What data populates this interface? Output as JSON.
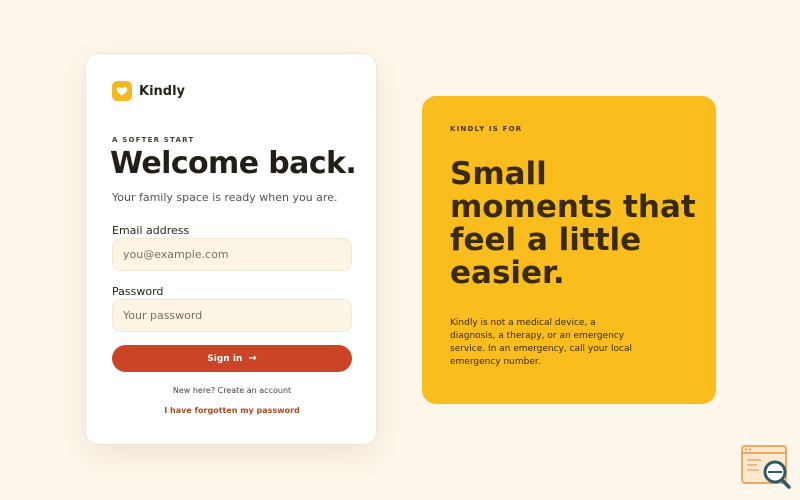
{
  "brand": {
    "name": "Kindly",
    "icon": "heart-icon",
    "accent": "#f5b820"
  },
  "login": {
    "eyebrow": "A SOFTER START",
    "title": "Welcome back.",
    "subtitle": "Your family space is ready when you are.",
    "email_label": "Email address",
    "email_value": "",
    "email_placeholder": "you@example.com",
    "password_label": "Password",
    "password_value": "",
    "password_placeholder": "Your password",
    "signin_label": "Sign in",
    "signin_icon": "arrow-right-icon",
    "create_account": "New here? Create an account",
    "forgot_password": "I have forgotten my password"
  },
  "promo": {
    "eyebrow": "KINDLY IS FOR",
    "headline": "Small moments that feel a little easier.",
    "body": "Kindly is not a medical device, a diagnosis, a therapy, or an emergency service. In an emergency, call your local emergency number."
  },
  "colors": {
    "page_background": "#fdf6ea",
    "card_background": "#ffffff",
    "field_background": "#fdf5e4",
    "signin_button": "#cc4426",
    "forgot_link": "#a84a1c",
    "promo_background": "#f9bd1e"
  },
  "corner_icon": "browser-search-icon"
}
